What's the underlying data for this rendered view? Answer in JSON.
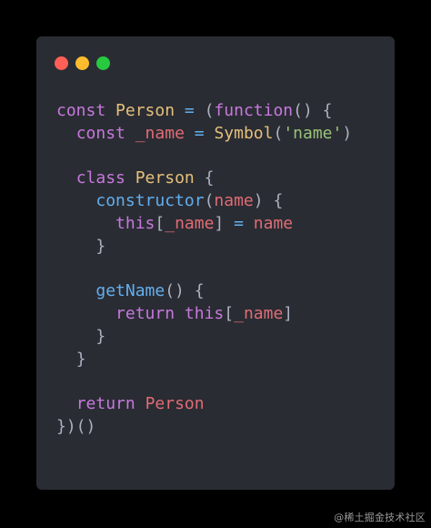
{
  "colors": {
    "background": "#000000",
    "card": "#2a2c33",
    "keyword": "#c678dd",
    "class": "#e5c07b",
    "function": "#61afef",
    "variable": "#e06c75",
    "string": "#98c379",
    "punctuation": "#abb2bf",
    "dot_red": "#ff5f56",
    "dot_yellow": "#ffbd2e",
    "dot_green": "#27c93f"
  },
  "window": {
    "controls": [
      "close-dot",
      "minimize-dot",
      "maximize-dot"
    ]
  },
  "code": {
    "l1": {
      "kw": "const",
      "sp1": " ",
      "name": "Person",
      "sp2": " ",
      "eq": "=",
      "sp3": " ",
      "open": "(",
      "fnkw": "function",
      "paren": "()",
      "sp4": " ",
      "brace": "{"
    },
    "l2": {
      "indent": "  ",
      "kw": "const",
      "sp1": " ",
      "var": "_name",
      "sp2": " ",
      "eq": "=",
      "sp3": " ",
      "fn": "Symbol",
      "open": "(",
      "str": "'name'",
      "close": ")"
    },
    "l3": {
      "text": ""
    },
    "l4": {
      "indent": "  ",
      "kw": "class",
      "sp1": " ",
      "name": "Person",
      "sp2": " ",
      "brace": "{"
    },
    "l5": {
      "indent": "    ",
      "fn": "constructor",
      "open": "(",
      "param": "name",
      "close": ")",
      "sp": " ",
      "brace": "{"
    },
    "l6": {
      "indent": "      ",
      "kw": "this",
      "open": "[",
      "var": "_name",
      "close": "]",
      "sp1": " ",
      "eq": "=",
      "sp2": " ",
      "val": "name"
    },
    "l7": {
      "indent": "    ",
      "brace": "}"
    },
    "l8": {
      "text": ""
    },
    "l9": {
      "indent": "    ",
      "fn": "getName",
      "paren": "()",
      "sp": " ",
      "brace": "{"
    },
    "l10": {
      "indent": "      ",
      "kw": "return",
      "sp1": " ",
      "kw2": "this",
      "open": "[",
      "var": "_name",
      "close": "]"
    },
    "l11": {
      "indent": "    ",
      "brace": "}"
    },
    "l12": {
      "indent": "  ",
      "brace": "}"
    },
    "l13": {
      "text": ""
    },
    "l14": {
      "indent": "  ",
      "kw": "return",
      "sp": " ",
      "name": "Person"
    },
    "l15": {
      "text": "})()"
    }
  },
  "watermark": "@稀土掘金技术社区"
}
